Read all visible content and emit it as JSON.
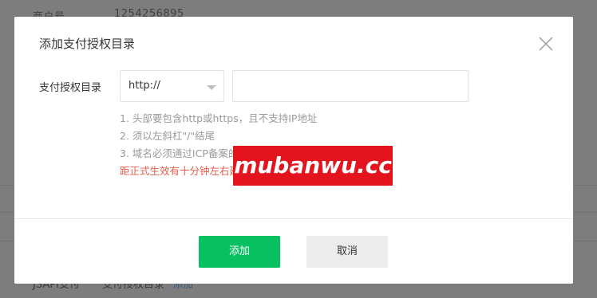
{
  "background": {
    "top_label": "商户号",
    "top_value": "1254256895",
    "bottom_label": "JSAPI支付",
    "bottom_value": "支付授权目录",
    "bottom_link": "添加"
  },
  "dialog": {
    "title": "添加支付授权目录",
    "field_label": "支付授权目录",
    "protocol_select": {
      "value": "http://"
    },
    "path_input": {
      "value": "",
      "placeholder": ""
    },
    "notes": [
      "1. 头部要包含http或https，且不支持IP地址",
      "2. 须以左斜杠\"/\"结尾",
      "3. 域名必须通过ICP备案的验证"
    ],
    "warning": "距正式生效有十分钟左右延迟，建议避开交易高峰时间添加",
    "confirm_label": "添加",
    "cancel_label": "取消"
  },
  "watermark": {
    "text": "mubanwu.cc"
  },
  "colors": {
    "primary": "#07c160",
    "warning": "#e55c4b",
    "watermark_bg": "#e4141e",
    "overlay": "#7d7d7d"
  }
}
